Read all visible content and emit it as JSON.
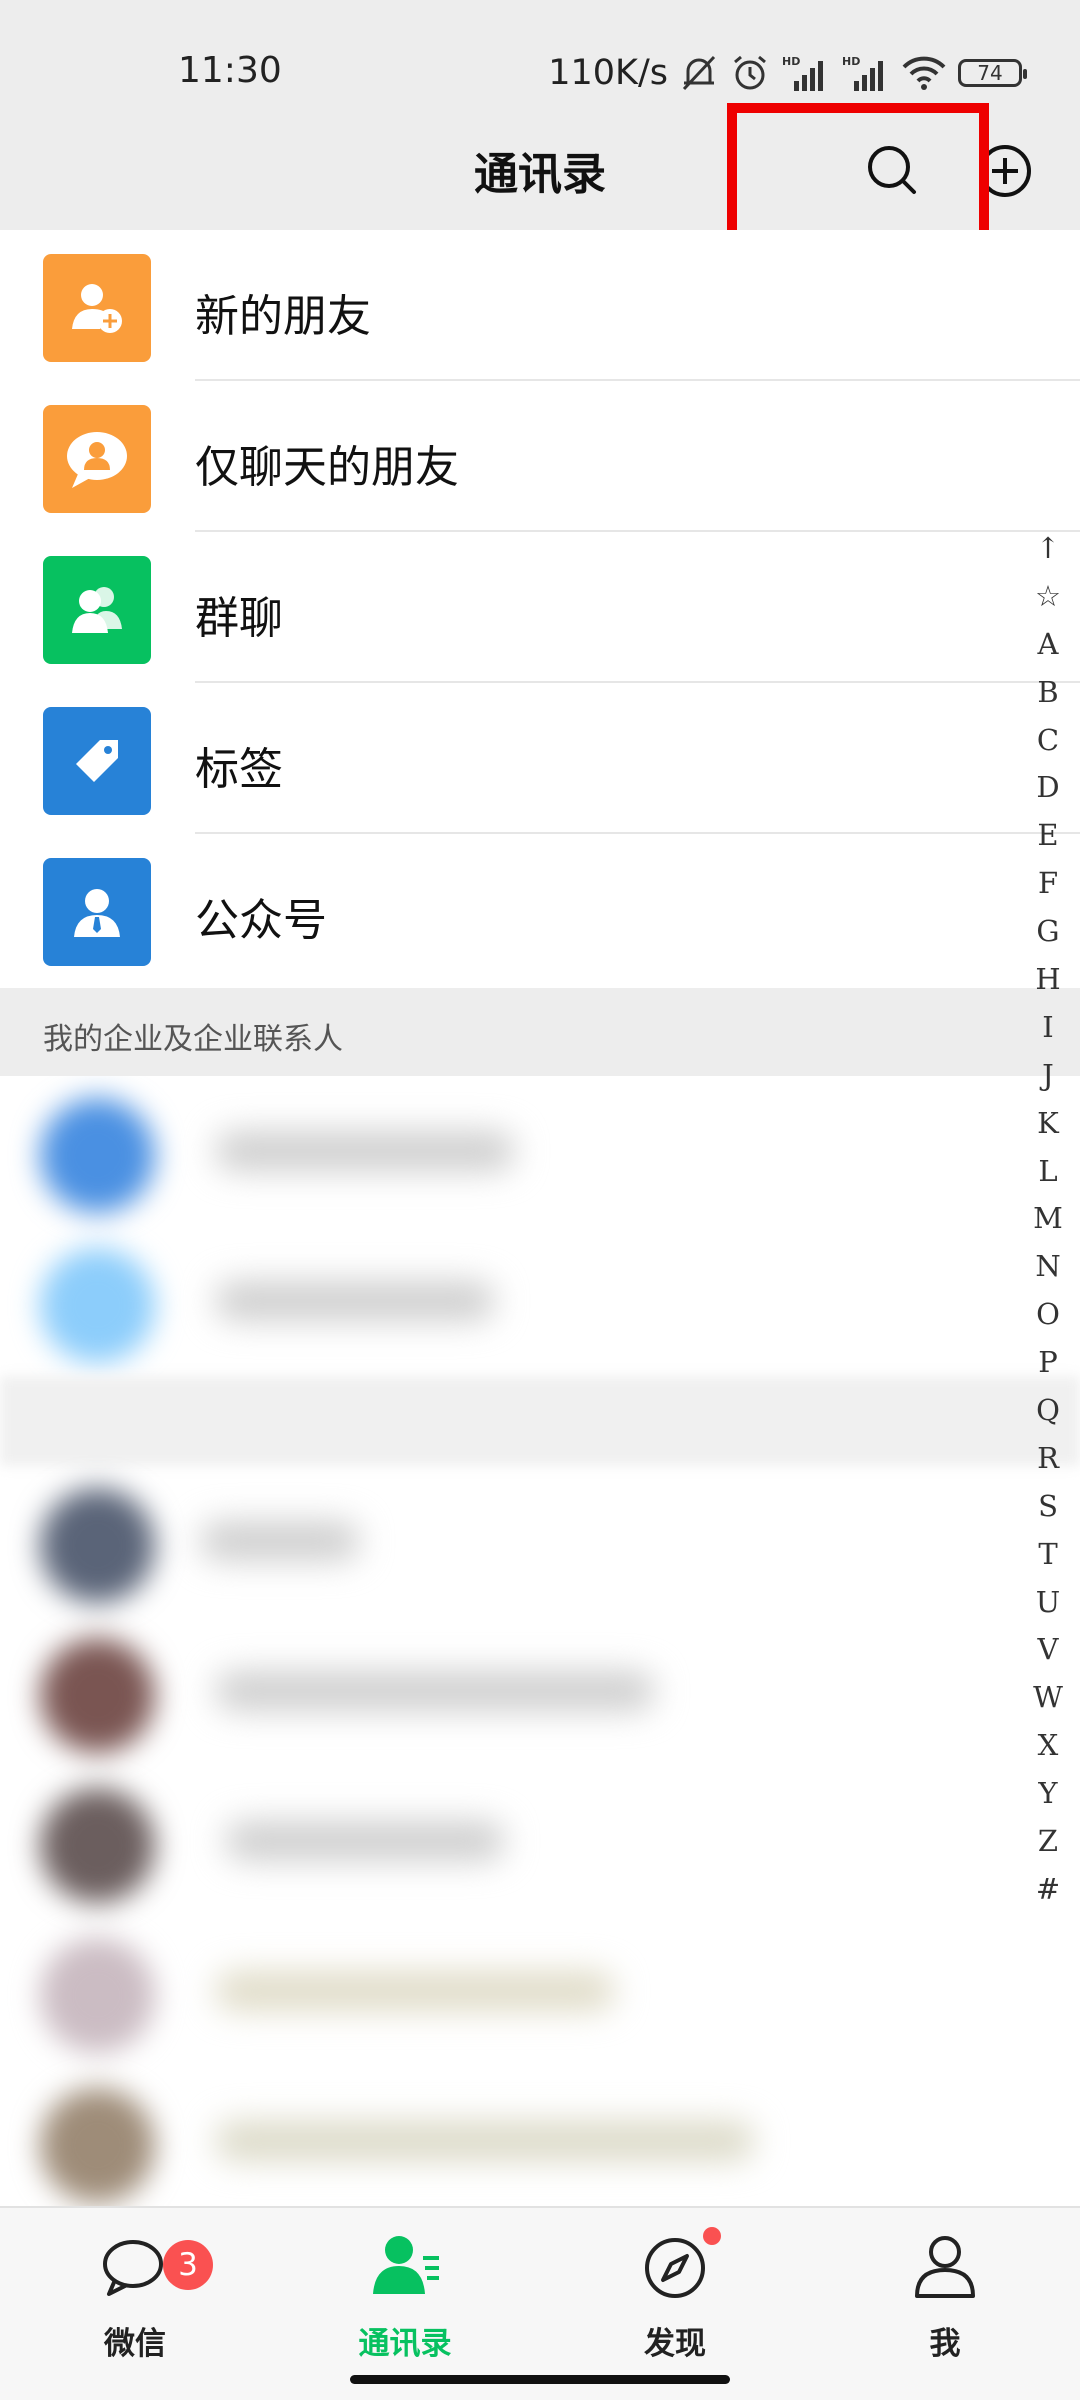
{
  "status_bar": {
    "time": "11:30",
    "net_speed": "110K/s",
    "battery": "74",
    "icons": [
      "bell-muted-icon",
      "alarm-icon",
      "signal-hd-icon",
      "signal-hd-icon",
      "wifi-icon",
      "battery-icon"
    ]
  },
  "header": {
    "title": "通讯录",
    "search_icon": "search-icon",
    "add_icon": "add-circle-icon"
  },
  "functions": [
    {
      "label": "新的朋友",
      "icon": "add-friend-icon",
      "color": "#fa9d3b"
    },
    {
      "label": "仅聊天的朋友",
      "icon": "chat-only-friend-icon",
      "color": "#fa9d3b"
    },
    {
      "label": "群聊",
      "icon": "group-chat-icon",
      "color": "#07c160"
    },
    {
      "label": "标签",
      "icon": "tag-icon",
      "color": "#2782d7"
    },
    {
      "label": "公众号",
      "icon": "official-account-icon",
      "color": "#2782d7"
    }
  ],
  "section": {
    "label": "我的企业及企业联系人"
  },
  "alphabet_index": [
    "↑",
    "☆",
    "A",
    "B",
    "C",
    "D",
    "E",
    "F",
    "G",
    "H",
    "I",
    "J",
    "K",
    "L",
    "M",
    "N",
    "O",
    "P",
    "Q",
    "R",
    "S",
    "T",
    "U",
    "V",
    "W",
    "X",
    "Y",
    "Z",
    "#"
  ],
  "tabbar": {
    "tabs": [
      {
        "label": "微信",
        "icon": "chat-bubble-icon",
        "badge": "3"
      },
      {
        "label": "通讯录",
        "icon": "contacts-icon",
        "active": true
      },
      {
        "label": "发现",
        "icon": "compass-icon",
        "dot": true
      },
      {
        "label": "我",
        "icon": "person-icon"
      }
    ]
  },
  "colors": {
    "accent": "#07c160",
    "header_bg": "#ededed",
    "badge": "#fa5151",
    "highlight": "#ee0000"
  }
}
